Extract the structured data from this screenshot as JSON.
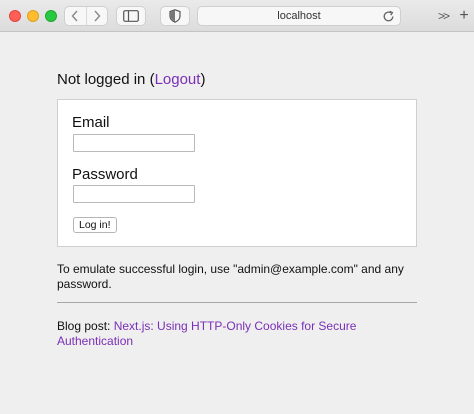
{
  "browser": {
    "url": "localhost",
    "colors": {
      "close": "#ff5f57",
      "minimize": "#febc2e",
      "zoom": "#28c840"
    },
    "icons": {
      "back": "chevron-left-icon",
      "forward": "chevron-right-icon",
      "sidebar": "sidebar-icon",
      "privacy": "shield-icon",
      "reload": "reload-icon",
      "overflow": "double-chevron-right-icon",
      "new_tab": "plus-icon"
    },
    "overflow_glyph": ">>",
    "new_tab_glyph": "+"
  },
  "status": {
    "prefix": "Not logged in (",
    "link": "Logout",
    "suffix": ")"
  },
  "form": {
    "email_label": "Email",
    "email_value": "",
    "password_label": "Password",
    "password_value": "",
    "submit_label": "Log in!"
  },
  "hint": {
    "text": "To emulate successful login, use \"admin@example.com\" and any password."
  },
  "blog": {
    "prefix": "Blog post: ",
    "link": "Next.js: Using HTTP-Only Cookies for Secure Authentication"
  },
  "colors": {
    "link": "#7a2fb8",
    "page_background": "#efefef"
  }
}
